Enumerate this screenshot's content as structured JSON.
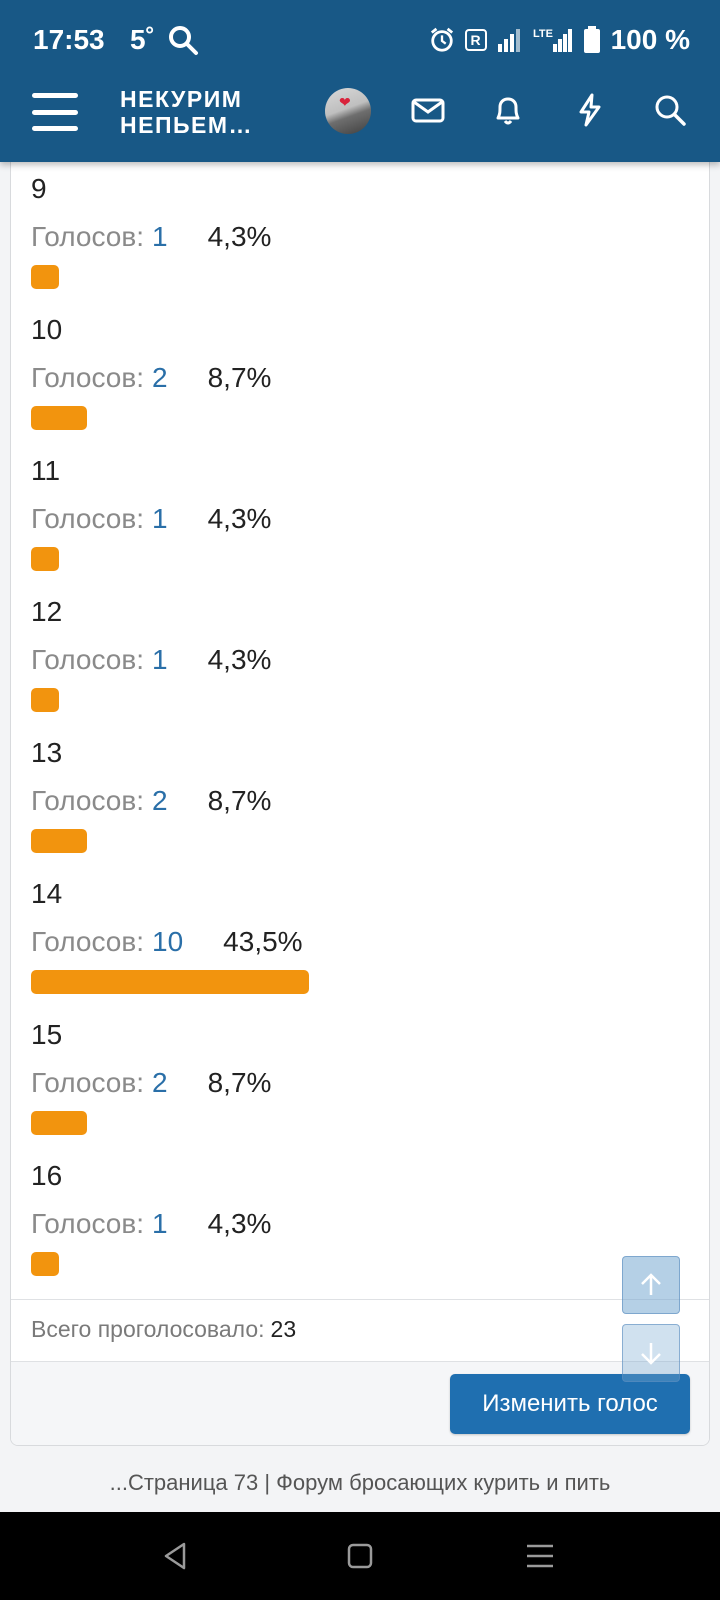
{
  "status_bar": {
    "time": "17:53",
    "temperature": "5˚",
    "network": "LTE",
    "roaming_badge": "R",
    "battery": "100 %"
  },
  "app_bar": {
    "logo_line1": "НЕКУРИМ",
    "logo_line2": "НЕПЬЕМ…",
    "icons": [
      "menu-icon",
      "avatar",
      "envelope-icon",
      "bell-icon",
      "lightning-icon",
      "search-icon"
    ]
  },
  "poll": {
    "votes_label": "Голосов:",
    "options": [
      {
        "label": "9",
        "votes": "1",
        "percent": "4,3%",
        "share": 0.043
      },
      {
        "label": "10",
        "votes": "2",
        "percent": "8,7%",
        "share": 0.087
      },
      {
        "label": "11",
        "votes": "1",
        "percent": "4,3%",
        "share": 0.043
      },
      {
        "label": "12",
        "votes": "1",
        "percent": "4,3%",
        "share": 0.043
      },
      {
        "label": "13",
        "votes": "2",
        "percent": "8,7%",
        "share": 0.087
      },
      {
        "label": "14",
        "votes": "10",
        "percent": "43,5%",
        "share": 0.435
      },
      {
        "label": "15",
        "votes": "2",
        "percent": "8,7%",
        "share": 0.087
      },
      {
        "label": "16",
        "votes": "1",
        "percent": "4,3%",
        "share": 0.043
      }
    ],
    "total_label": "Всего проголосовало:",
    "total_value": "23",
    "change_vote_button": "Изменить голос"
  },
  "page_caption": "...Страница 73 | Форум бросающих курить и пить",
  "colors": {
    "header_bg": "#185886",
    "bar_fill": "#f2940e",
    "link_blue": "#2a6fa8",
    "button_blue": "#1f6fb0"
  }
}
